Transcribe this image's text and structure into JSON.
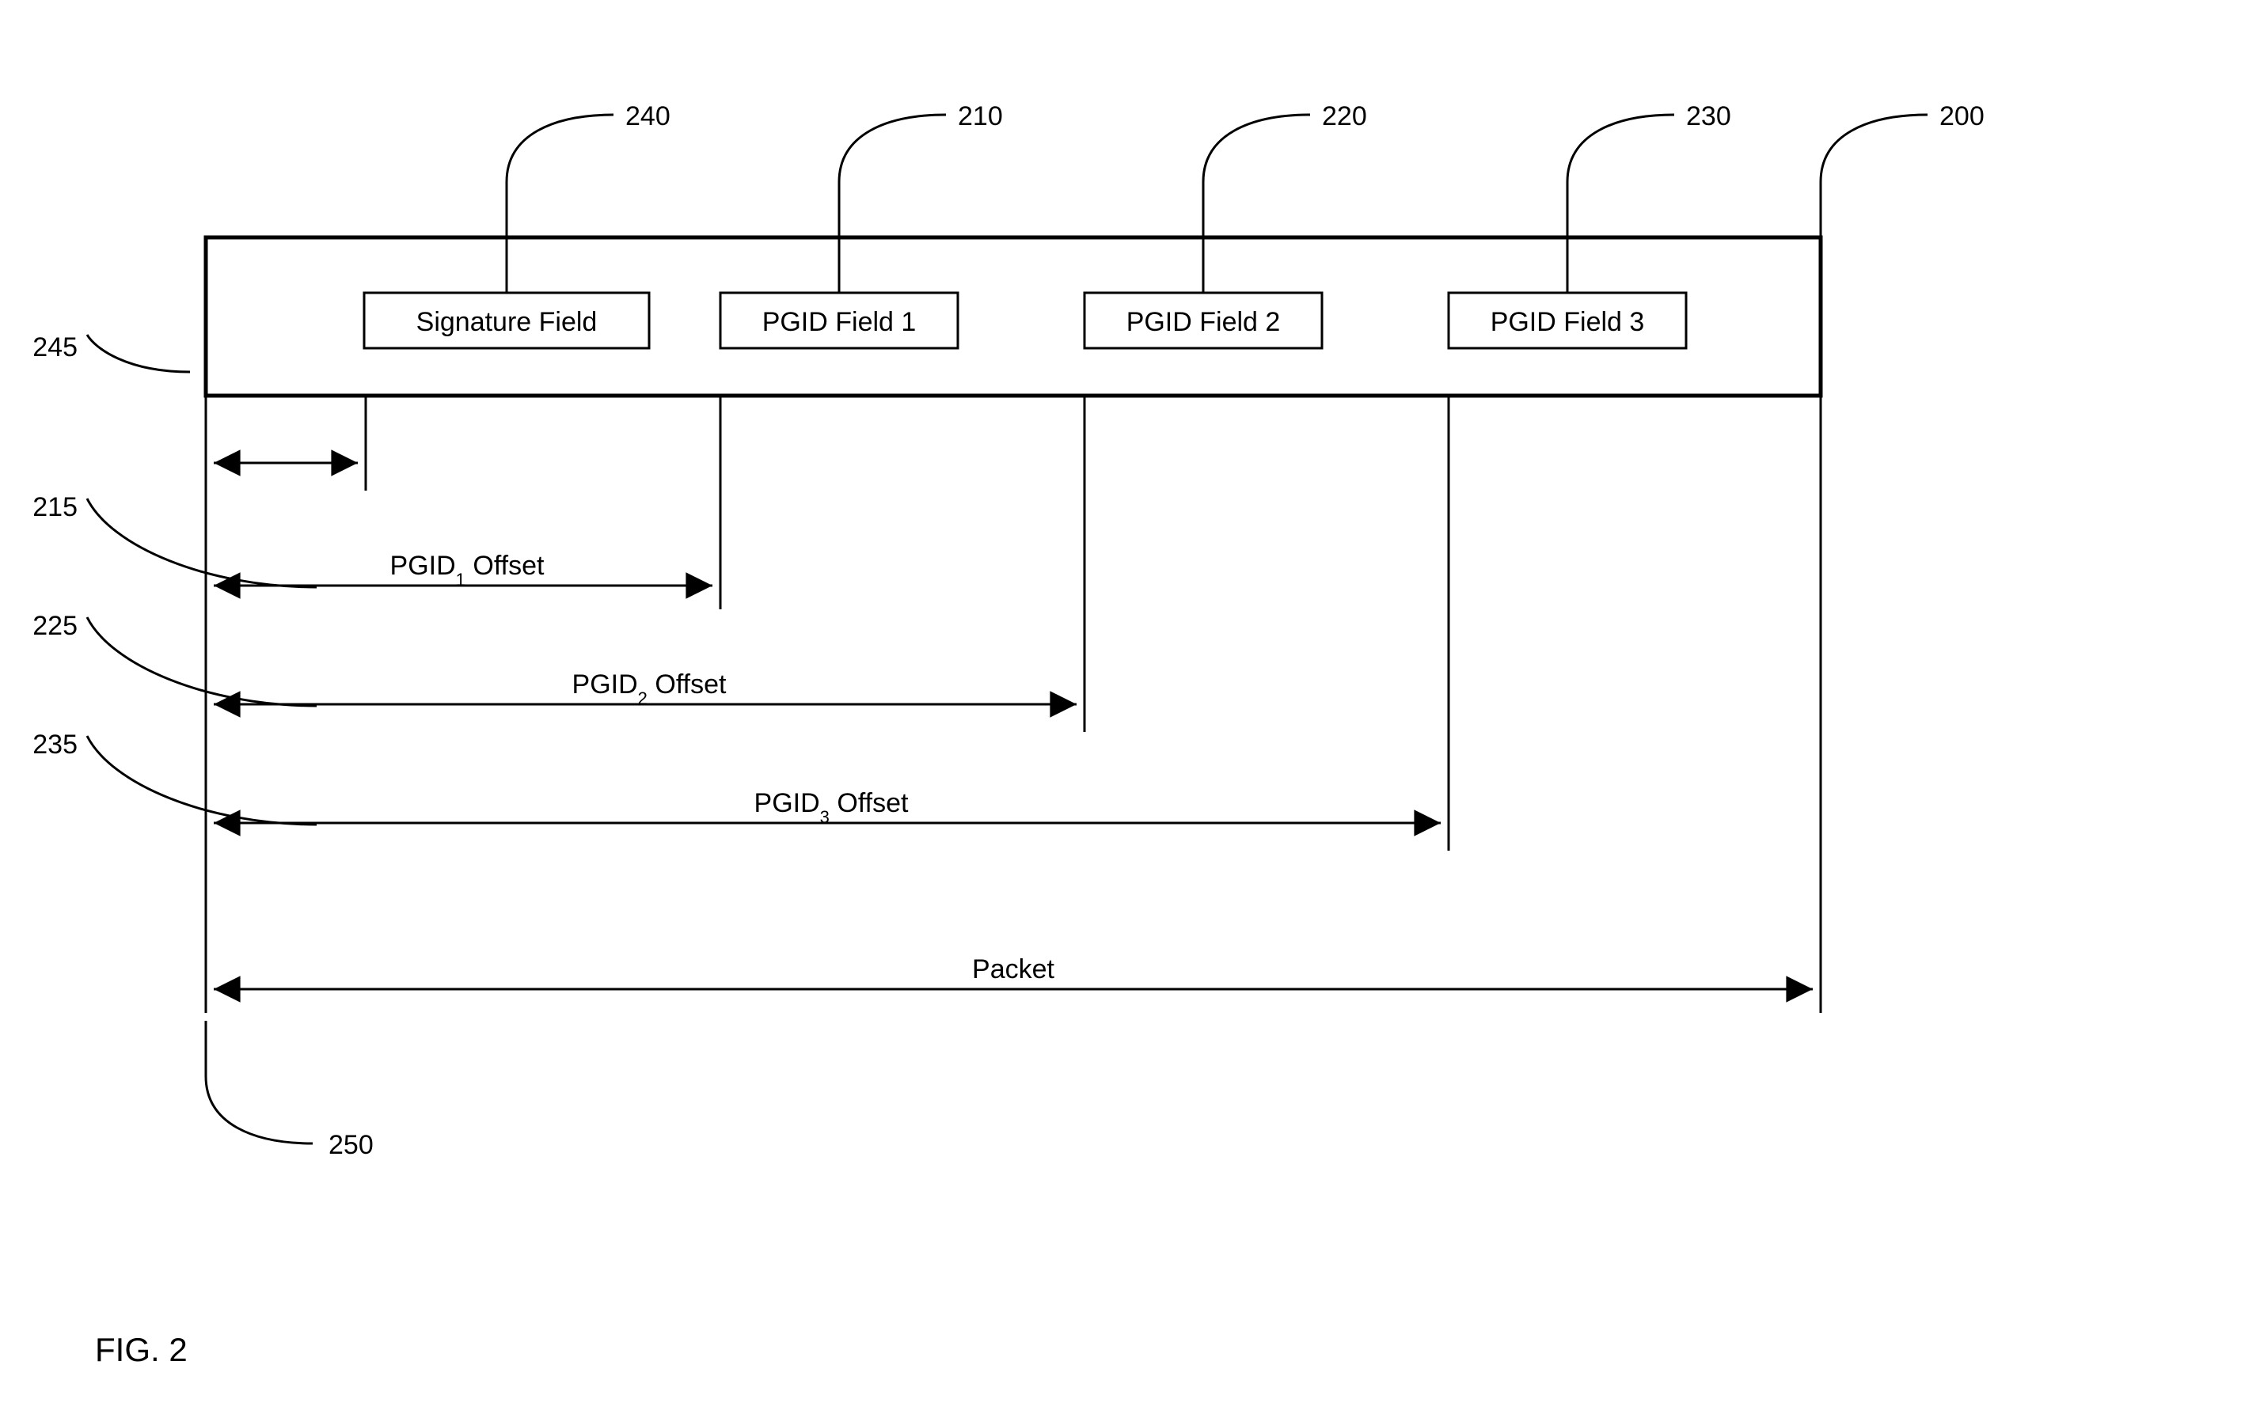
{
  "figureLabel": "FIG. 2",
  "packet": {
    "label": "Packet"
  },
  "fields": {
    "signature": {
      "label": "Signature Field",
      "ref": "240"
    },
    "pgid1": {
      "label": "PGID Field 1",
      "ref": "210"
    },
    "pgid2": {
      "label": "PGID Field 2",
      "ref": "220"
    },
    "pgid3": {
      "label": "PGID Field 3",
      "ref": "230"
    }
  },
  "offsets": {
    "pgid1": {
      "label_prefix": "PGID",
      "label_sub": "1",
      "label_suffix": " Offset",
      "ref": "215"
    },
    "pgid2": {
      "label_prefix": "PGID",
      "label_sub": "2",
      "label_suffix": " Offset",
      "ref": "225"
    },
    "pgid3": {
      "label_prefix": "PGID",
      "label_sub": "3",
      "label_suffix": " Offset",
      "ref": "235"
    }
  },
  "sigOffset": {
    "ref": "245"
  },
  "packetRef": {
    "ref": "200"
  },
  "stamp": {
    "ref": "250"
  }
}
